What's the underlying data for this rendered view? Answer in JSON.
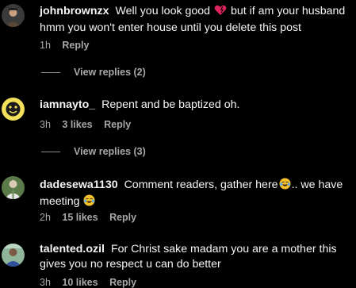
{
  "comments": [
    {
      "username": "johnbrownzx",
      "text_before": "Well you look good",
      "emoji_mid": "heart-icon",
      "text_after": "but if am your husband hmm you won't enter house until you delete this post",
      "time": "1h",
      "likes": "",
      "reply_label": "Reply",
      "view_replies": "View replies (2)"
    },
    {
      "username": "iamnayto_",
      "text": "Repent and be baptized oh.",
      "time": "3h",
      "likes": "3 likes",
      "reply_label": "Reply",
      "view_replies": "View replies (3)"
    },
    {
      "username": "dadesewa1130",
      "text_part1": "Comment readers, gather here",
      "text_part2": ".. we have meeting",
      "emoji": "laughing-emoji",
      "time": "2h",
      "likes": "15 likes",
      "reply_label": "Reply"
    },
    {
      "username": "talented.ozil",
      "text": "For Christ sake madam you are a mother this gives you no respect u can do better",
      "time": "3h",
      "likes": "10 likes",
      "reply_label": "Reply"
    }
  ],
  "colors": {
    "background": "#000000",
    "text": "#f5f5f5",
    "muted": "#a8a8a8",
    "heart": "#e0245e",
    "emoji_face": "#f7c22c"
  }
}
